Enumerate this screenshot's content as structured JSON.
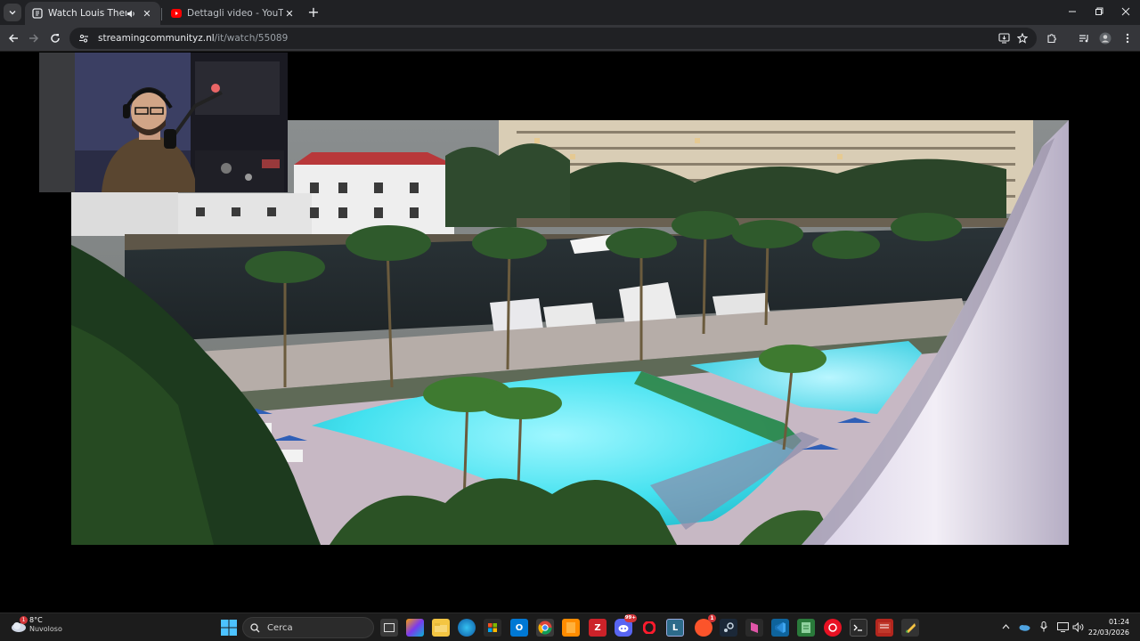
{
  "browser": {
    "tabs": [
      {
        "title": "Watch Louis Theroux: denti",
        "active": true
      },
      {
        "title": "Dettagli video - YouTube Studio",
        "active": false
      }
    ],
    "new_tab_label": "+",
    "url_host": "streamingcommunityz.nl",
    "url_path": "/it/watch/55089"
  },
  "taskbar": {
    "weather": {
      "temp": "8°C",
      "condition": "Nuvoloso",
      "badge": "1"
    },
    "search_label": "Cerca",
    "clock": {
      "time": "01:24",
      "date": "22/03/2026"
    },
    "badges": {
      "discord": "99+",
      "brave": "1"
    }
  },
  "colors": {
    "tabstrip": "#202124",
    "toolbar": "#35363a",
    "omnibox": "#202124",
    "taskbar": "#1c1c1c",
    "pool": "#3fe0ef"
  }
}
